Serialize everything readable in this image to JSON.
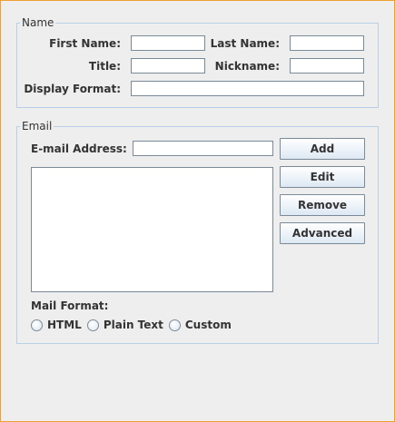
{
  "name_group": {
    "legend": "Name",
    "first_name_label": "First Name:",
    "first_name_value": "",
    "last_name_label": "Last Name:",
    "last_name_value": "",
    "title_label": "Title:",
    "title_value": "",
    "nickname_label": "Nickname:",
    "nickname_value": "",
    "display_format_label": "Display Format:",
    "display_format_value": ""
  },
  "email_group": {
    "legend": "Email",
    "email_address_label": "E-mail Address:",
    "email_address_value": "",
    "buttons": {
      "add": "Add",
      "edit": "Edit",
      "remove": "Remove",
      "advanced": "Advanced"
    },
    "email_list": [],
    "mail_format_label": "Mail Format:",
    "mail_format_options": [
      "HTML",
      "Plain Text",
      "Custom"
    ],
    "mail_format_selected": null
  },
  "colors": {
    "background": "#eeeeee",
    "group_border": "#b8cfe5",
    "frame_border": "#f0a030",
    "field_border": "#7a8a99"
  }
}
